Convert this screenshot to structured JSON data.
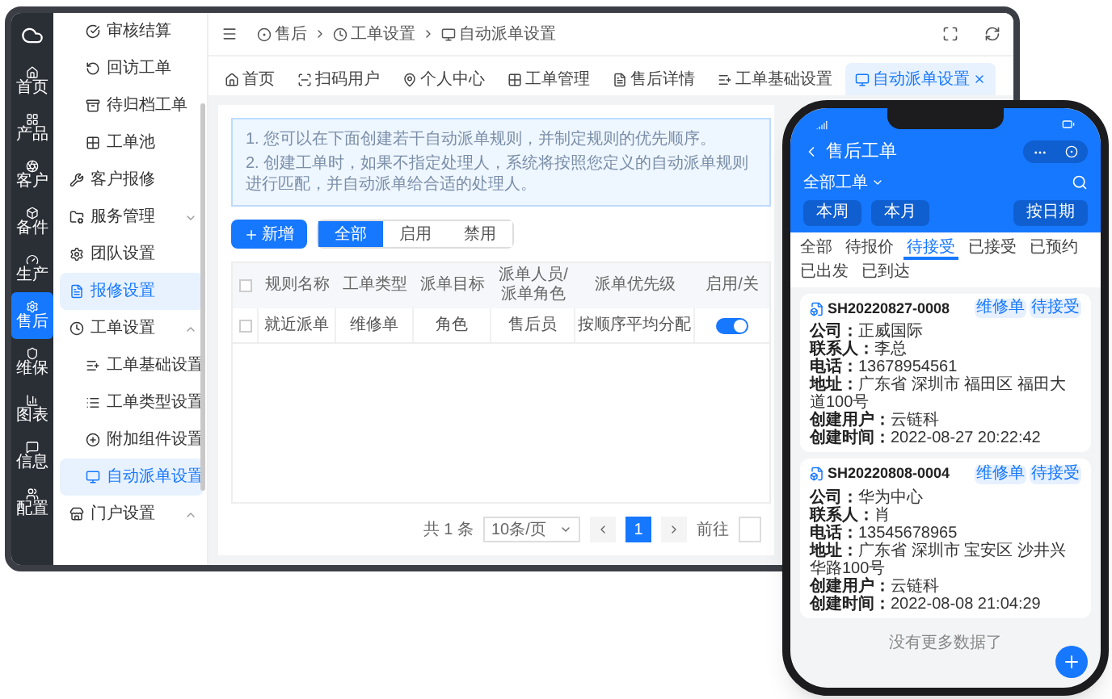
{
  "rail": {
    "items": [
      {
        "label": "首页",
        "selected": false
      },
      {
        "label": "产品",
        "selected": false
      },
      {
        "label": "客户",
        "selected": false
      },
      {
        "label": "备件",
        "selected": false
      },
      {
        "label": "生产",
        "selected": false
      },
      {
        "label": "售后",
        "selected": true
      },
      {
        "label": "维保",
        "selected": false
      },
      {
        "label": "图表",
        "selected": false
      },
      {
        "label": "信息",
        "selected": false
      },
      {
        "label": "配置",
        "selected": false
      }
    ]
  },
  "sidebar": {
    "scrolled_group_children": [
      {
        "label": "审核结算",
        "selected": false
      },
      {
        "label": "回访工单",
        "selected": false
      },
      {
        "label": "待归档工单",
        "selected": false
      },
      {
        "label": "工单池",
        "selected": false
      }
    ],
    "items": [
      {
        "label": "客户报修",
        "kind": "link",
        "selected": false
      },
      {
        "label": "服务管理",
        "kind": "group",
        "expanded": false,
        "selected": false
      },
      {
        "label": "团队设置",
        "kind": "link",
        "selected": false
      },
      {
        "label": "报修设置",
        "kind": "link",
        "selected": true
      },
      {
        "label": "工单设置",
        "kind": "group",
        "expanded": true,
        "selected": false,
        "children": [
          {
            "label": "工单基础设置",
            "selected": false
          },
          {
            "label": "工单类型设置",
            "selected": false
          },
          {
            "label": "附加组件设置",
            "selected": false
          },
          {
            "label": "自动派单设置",
            "selected": true
          }
        ]
      },
      {
        "label": "门户设置",
        "kind": "group",
        "expanded": true,
        "selected": false
      }
    ]
  },
  "breadcrumb": [
    "售后",
    "工单设置",
    "自动派单设置"
  ],
  "tabs": [
    {
      "label": "首页",
      "selected": false
    },
    {
      "label": "扫码用户",
      "selected": false
    },
    {
      "label": "个人中心",
      "selected": false
    },
    {
      "label": "工单管理",
      "selected": false
    },
    {
      "label": "售后详情",
      "selected": false
    },
    {
      "label": "工单基础设置",
      "selected": false
    },
    {
      "label": "自动派单设置",
      "selected": true
    }
  ],
  "notice": [
    "1. 您可以在下面创建若干自动派单规则，并制定规则的优先顺序。",
    "2. 创建工单时，如果不指定处理人，系统将按照您定义的自动派单规则进行匹配，并自动派单给合适的处理人。"
  ],
  "add_button": "新增",
  "filters": [
    {
      "label": "全部",
      "selected": true
    },
    {
      "label": "启用",
      "selected": false
    },
    {
      "label": "禁用",
      "selected": false
    }
  ],
  "table": {
    "header_checked": false,
    "columns": [
      "规则名称",
      "工单类型",
      "派单目标",
      "派单人员/派单角色",
      "派单优先级",
      "启用/关"
    ],
    "rows": [
      {
        "checked": false,
        "cells": [
          "就近派单",
          "维修单",
          "角色",
          "售后员",
          "按顺序平均分配"
        ],
        "enabled": true
      }
    ]
  },
  "pagination": {
    "total": "共 1 条",
    "page_size": "10条/页",
    "pages": [
      {
        "label": "1",
        "selected": true
      }
    ],
    "goto": "前往"
  },
  "phone": {
    "title": "售后工单",
    "filter": "全部工单",
    "ranges": [
      "本周",
      "本月"
    ],
    "date_button": "按日期",
    "tabs": [
      {
        "label": "全部",
        "selected": false
      },
      {
        "label": "待报价",
        "selected": false
      },
      {
        "label": "待接受",
        "selected": true
      },
      {
        "label": "已接受",
        "selected": false
      },
      {
        "label": "已预约",
        "selected": false
      },
      {
        "label": "已出发",
        "selected": false
      },
      {
        "label": "已到达",
        "selected": false
      }
    ],
    "orders": [
      {
        "number": "SH20220827-0008",
        "tags": [
          "维修单",
          "待接受"
        ],
        "fields": [
          {
            "label": "公司：",
            "value": "正威国际"
          },
          {
            "label": "联系人：",
            "value": "李总"
          },
          {
            "label": "电话：",
            "value": "13678954561"
          },
          {
            "label": "地址：",
            "value": "广东省 深圳市 福田区 福田大道100号"
          },
          {
            "label": "创建用户：",
            "value": "云链科"
          },
          {
            "label": "创建时间：",
            "value": "2022-08-27 20:22:42"
          }
        ]
      },
      {
        "number": "SH20220808-0004",
        "tags": [
          "维修单",
          "待接受"
        ],
        "fields": [
          {
            "label": "公司：",
            "value": "华为中心"
          },
          {
            "label": "联系人：",
            "value": "肖"
          },
          {
            "label": "电话：",
            "value": "13545678965"
          },
          {
            "label": "地址：",
            "value": "广东省 深圳市 宝安区 沙井兴华路100号"
          },
          {
            "label": "创建用户：",
            "value": "云链科"
          },
          {
            "label": "创建时间：",
            "value": "2022-08-08 21:04:29"
          }
        ]
      }
    ],
    "footer": "没有更多数据了"
  }
}
